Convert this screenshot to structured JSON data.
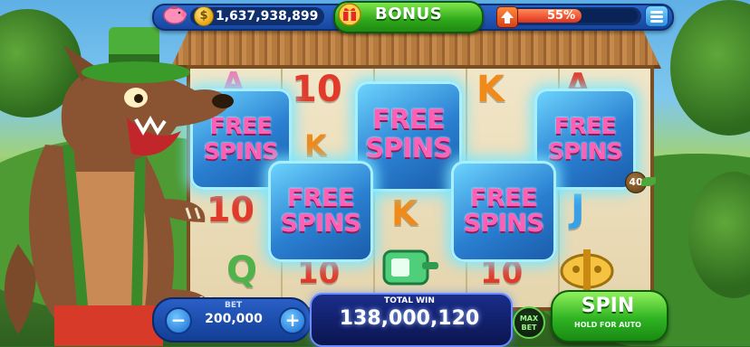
{
  "topbar": {
    "piggy_icon": "piggy-bank-icon",
    "coin_icon": "coin-icon",
    "coin_symbol": "$",
    "balance": "1,637,938,899",
    "bonus_label": "BONUS",
    "gift_icon": "gift-icon",
    "level_icon": "level-up-icon",
    "xp_progress_percent": 55,
    "xp_text": "55%",
    "menu_icon": "menu-icon"
  },
  "reels": {
    "symbols": [
      {
        "text": "A",
        "color": "pink"
      },
      {
        "text": "10",
        "color": "red"
      },
      {
        "text": "K",
        "color": "orange"
      },
      {
        "text": "A",
        "color": "red"
      },
      {
        "text": "K",
        "color": "orange"
      },
      {
        "text": "10",
        "color": "red"
      },
      {
        "text": "K",
        "color": "orange"
      },
      {
        "text": "J",
        "color": "blue"
      },
      {
        "text": "Q",
        "color": "green"
      },
      {
        "text": "10",
        "color": "red"
      },
      {
        "text": "10",
        "color": "red"
      }
    ],
    "free_spins": [
      {
        "line1": "FREE",
        "line2": "SPINS"
      },
      {
        "line1": "FREE",
        "line2": "SPINS"
      },
      {
        "line1": "FREE",
        "line2": "SPINS"
      },
      {
        "line1": "FREE",
        "line2": "SPINS"
      },
      {
        "line1": "FREE",
        "line2": "SPINS"
      }
    ],
    "multiplier_badge": "40"
  },
  "controls": {
    "bet_label": "BET",
    "bet_value": "200,000",
    "minus": "−",
    "plus": "+",
    "total_win_label": "TOTAL WIN",
    "total_win_value": "138,000,120",
    "max_bet_line1": "MAX",
    "max_bet_line2": "BET",
    "spin_label": "SPIN",
    "spin_sub": "HOLD FOR AUTO"
  },
  "colors": {
    "accent_green": "#2fb323",
    "panel_blue": "#1846a0",
    "free_spins_pink": "#ff5fb5"
  }
}
